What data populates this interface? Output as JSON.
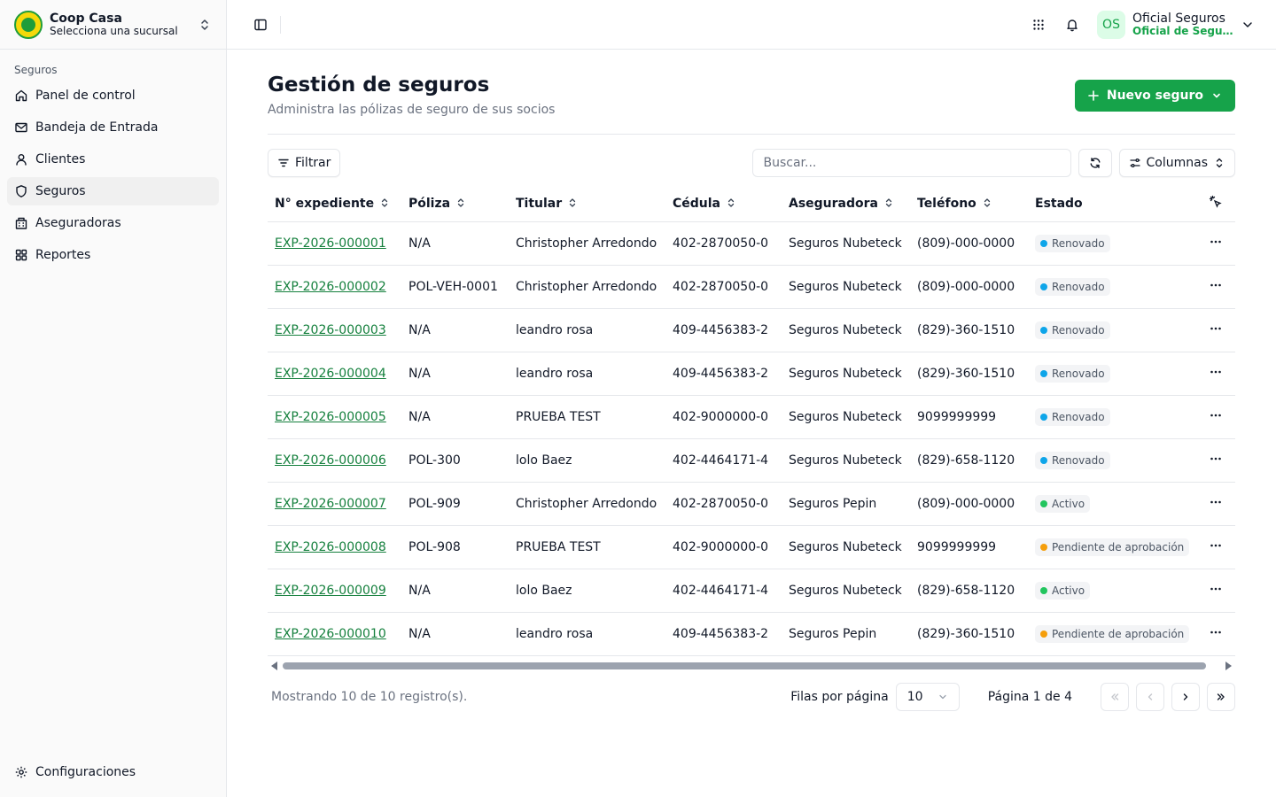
{
  "org": {
    "name": "Coop Casa",
    "subtitle": "Selecciona una sucursal"
  },
  "sidebar": {
    "group_label": "Seguros",
    "items": [
      {
        "label": "Panel de control",
        "icon": "home-icon"
      },
      {
        "label": "Bandeja de Entrada",
        "icon": "mail-icon"
      },
      {
        "label": "Clientes",
        "icon": "user-icon"
      },
      {
        "label": "Seguros",
        "icon": "shield-icon",
        "active": true
      },
      {
        "label": "Aseguradoras",
        "icon": "building-icon"
      },
      {
        "label": "Reportes",
        "icon": "grid-icon"
      }
    ],
    "settings_label": "Configuraciones"
  },
  "user": {
    "initials": "OS",
    "name": "Oficial Seguros",
    "role": "Oficial de Seguros"
  },
  "page": {
    "title": "Gestión de seguros",
    "subtitle": "Administra las pólizas de seguro de sus socios",
    "new_button": "Nuevo seguro"
  },
  "toolbar": {
    "filter_label": "Filtrar",
    "search_placeholder": "Buscar...",
    "columns_label": "Columnas"
  },
  "table": {
    "columns": [
      "N° expediente",
      "Póliza",
      "Titular",
      "Cédula",
      "Aseguradora",
      "Teléfono",
      "Estado"
    ],
    "rows": [
      [
        "EXP-2026-000001",
        "N/A",
        "Christopher Arredondo",
        "402-2870050-0",
        "Seguros Nubeteck",
        "(809)-000-0000",
        "Renovado"
      ],
      [
        "EXP-2026-000002",
        "POL-VEH-0001",
        "Christopher Arredondo",
        "402-2870050-0",
        "Seguros Nubeteck",
        "(809)-000-0000",
        "Renovado"
      ],
      [
        "EXP-2026-000003",
        "N/A",
        "leandro rosa",
        "409-4456383-2",
        "Seguros Nubeteck",
        "(829)-360-1510",
        "Renovado"
      ],
      [
        "EXP-2026-000004",
        "N/A",
        "leandro rosa",
        "409-4456383-2",
        "Seguros Nubeteck",
        "(829)-360-1510",
        "Renovado"
      ],
      [
        "EXP-2026-000005",
        "N/A",
        "PRUEBA TEST",
        "402-9000000-0",
        "Seguros Nubeteck",
        "9099999999",
        "Renovado"
      ],
      [
        "EXP-2026-000006",
        "POL-300",
        "lolo Baez",
        "402-4464171-4",
        "Seguros Nubeteck",
        "(829)-658-1120",
        "Renovado"
      ],
      [
        "EXP-2026-000007",
        "POL-909",
        "Christopher Arredondo",
        "402-2870050-0",
        "Seguros Pepin",
        "(809)-000-0000",
        "Activo"
      ],
      [
        "EXP-2026-000008",
        "POL-908",
        "PRUEBA TEST",
        "402-9000000-0",
        "Seguros Nubeteck",
        "9099999999",
        "Pendiente de aprobación"
      ],
      [
        "EXP-2026-000009",
        "N/A",
        "lolo Baez",
        "402-4464171-4",
        "Seguros Nubeteck",
        "(829)-658-1120",
        "Activo"
      ],
      [
        "EXP-2026-000010",
        "N/A",
        "leandro rosa",
        "409-4456383-2",
        "Seguros Pepin",
        "(829)-360-1510",
        "Pendiente de aprobación"
      ]
    ],
    "status_colors": {
      "Renovado": "#0ea5e9",
      "Activo": "#22c55e",
      "Pendiente de aprobación": "#f59e0b"
    }
  },
  "pagination": {
    "showing": "Mostrando 10 de 10 registro(s).",
    "rows_label": "Filas por página",
    "rows_value": "10",
    "page_info": "Página 1 de 4"
  },
  "colors": {
    "accent": "#16a34a",
    "link": "#15803d"
  }
}
